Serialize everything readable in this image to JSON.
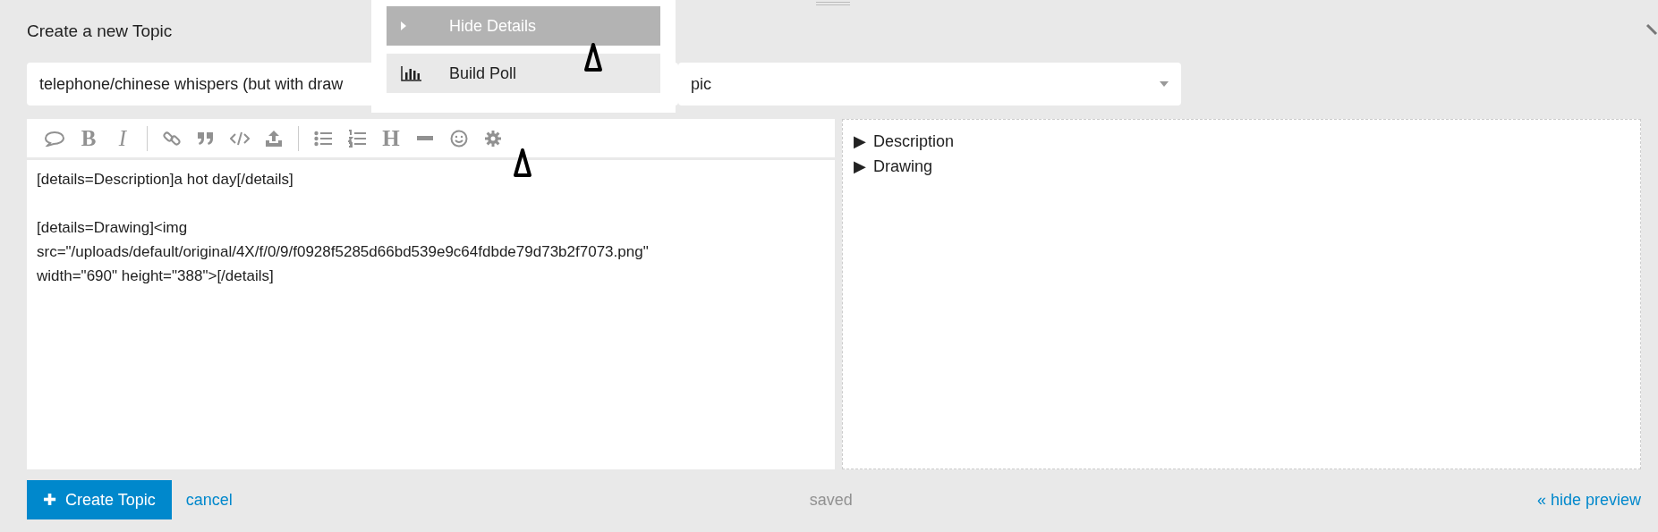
{
  "composer": {
    "title": "Create a new Topic",
    "topic_title": {
      "value": "telephone/chinese whispers (but with draw"
    },
    "category": {
      "value": "pic"
    },
    "popup_menu": [
      {
        "label": "Hide Details",
        "selected": true
      },
      {
        "label": "Build Poll",
        "selected": false
      }
    ],
    "toolbar": [
      [
        {
          "kind": "icon"
        },
        {
          "kind": "glyph",
          "label": "B",
          "italic": false
        },
        {
          "kind": "glyph",
          "label": "I",
          "italic": true
        }
      ],
      [
        {
          "kind": "icon"
        },
        {
          "kind": "icon"
        },
        {
          "kind": "icon"
        },
        {
          "kind": "icon"
        }
      ],
      [
        {
          "kind": "icon"
        },
        {
          "kind": "icon"
        },
        {
          "kind": "glyph",
          "label": "H",
          "italic": false
        },
        {
          "kind": "icon"
        },
        {
          "kind": "icon"
        },
        {
          "kind": "icon"
        }
      ]
    ],
    "editor_paragraphs": [
      [
        "[details=Description]a hot day[/details]"
      ],
      [
        "[details=Drawing]<img",
        "src=\"/uploads/default/original/4X/f/0/9/f0928f5285d66bd539e9c64fdbde79d73b2f7073.png\"",
        "width=\"690\" height=\"388\">[/details]"
      ]
    ],
    "preview": [
      {
        "marker": "▶",
        "label": "Description"
      },
      {
        "marker": "▶",
        "label": "Drawing"
      }
    ],
    "create_button": {
      "icon": "✚",
      "label": "Create Topic"
    },
    "cancel_link": "cancel",
    "status": "saved",
    "hide_preview_link": "« hide preview"
  }
}
